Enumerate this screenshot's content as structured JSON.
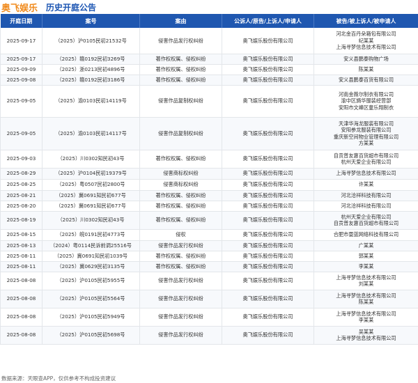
{
  "header": {
    "brand": "奥飞娱乐",
    "title": "历史开庭公告"
  },
  "table": {
    "columns": [
      "开庭日期",
      "案号",
      "案由",
      "公诉人/原告/上诉人/申请人",
      "被告/被上诉人/被申请人"
    ],
    "rows": [
      {
        "date": "2025-09-17",
        "case": "（2025）沪0105民初21532号",
        "cause": "侵害作品发行权纠纷",
        "plaintiff": "奥飞娱乐股份有限公司",
        "defendants": [
          "河北金百丹朵箱包有限公司",
          "纪某某",
          "上海寻梦信息技术有限公司"
        ]
      },
      {
        "date": "2025-09-17",
        "case": "（2025）赣0192民初3269号",
        "cause": "著作权权属、侵权纠纷",
        "plaintiff": "奥飞娱乐股份有限公司",
        "defendants": [
          "安义县鹏泰购物广场"
        ]
      },
      {
        "date": "2025-09-09",
        "case": "（2025）浙0213民初4896号",
        "cause": "著作权权属、侵权纠纷",
        "plaintiff": "奥飞娱乐股份有限公司",
        "defendants": [
          "陈某某"
        ]
      },
      {
        "date": "2025-09-08",
        "case": "（2025）赣0192民初3186号",
        "cause": "著作权权属、侵权纠纷",
        "plaintiff": "奥飞娱乐股份有限公司",
        "defendants": [
          "安义县鹏泰百货有限公司"
        ]
      },
      {
        "date": "2025-09-05",
        "case": "（2025）渝0103民初14119号",
        "cause": "侵害作品复制权纠纷",
        "plaintiff": "奥飞娱乐股份有限公司",
        "defendants": [
          "河南金薇尔制衣有限公司",
          "渝中区旖华服装经营部",
          "安阳市文峰区童乐翔制衣"
        ]
      },
      {
        "date": "2025-09-05",
        "case": "（2025）渝0103民初14117号",
        "cause": "侵害作品复制权纠纷",
        "plaintiff": "奥飞娱乐股份有限公司",
        "defendants": [
          "天津华海龙服装有限公司",
          "安阳参龙服装有限公司",
          "重庆新空间物业管理有限公司",
          "方某某"
        ]
      },
      {
        "date": "2025-09-03",
        "case": "（2025）川0302知民初43号",
        "cause": "著作权权属、侵权纠纷",
        "plaintiff": "奥飞娱乐股份有限公司",
        "defendants": [
          "自贡普友惠百货超市有限公司",
          "杭州天爱企业有限公司"
        ]
      },
      {
        "date": "2025-08-29",
        "case": "（2025）沪0104民初19379号",
        "cause": "侵害商标权纠纷",
        "plaintiff": "奥飞娱乐股份有限公司",
        "defendants": [
          "上海寻梦信息技术有限公司"
        ]
      },
      {
        "date": "2025-08-25",
        "case": "（2025）粤0507民初2800号",
        "cause": "侵害商标权纠纷",
        "plaintiff": "奥飞娱乐股份有限公司",
        "defendants": [
          "许某某"
        ]
      },
      {
        "date": "2025-08-21",
        "case": "（2025）冀0691知民初677号",
        "cause": "著作权权属、侵权纠纷",
        "plaintiff": "奥飞娱乐股份有限公司",
        "defendants": [
          "河北洽祥科技有限公司"
        ]
      },
      {
        "date": "2025-08-20",
        "case": "（2025）冀0691知民初677号",
        "cause": "著作权权属、侵权纠纷",
        "plaintiff": "奥飞娱乐股份有限公司",
        "defendants": [
          "河北洽祥科技有限公司"
        ]
      },
      {
        "date": "2025-08-19",
        "case": "（2025）川0302知民初43号",
        "cause": "著作权权属、侵权纠纷",
        "plaintiff": "奥飞娱乐股份有限公司",
        "defendants": [
          "杭州天爱企业有限公司",
          "自贡普友惠百货超市有限公司"
        ]
      },
      {
        "date": "2025-08-15",
        "case": "（2025）皖0191民初4773号",
        "cause": "侵权",
        "plaintiff": "奥飞娱乐股份有限公司",
        "defendants": [
          "合肥市耍蓝网络科技有限公司"
        ]
      },
      {
        "date": "2025-08-13",
        "case": "（2024）粤0114民诉前调25516号",
        "cause": "侵害作品发行权纠纷",
        "plaintiff": "奥飞娱乐股份有限公司",
        "defendants": [
          "广某某"
        ]
      },
      {
        "date": "2025-08-11",
        "case": "（2025）冀0691知民初1039号",
        "cause": "著作权权属、侵权纠纷",
        "plaintiff": "奥飞娱乐股份有限公司",
        "defendants": [
          "郭某某"
        ]
      },
      {
        "date": "2025-08-11",
        "case": "（2025）冀0629民初3135号",
        "cause": "著作权权属、侵权纠纷",
        "plaintiff": "奥飞娱乐股份有限公司",
        "defendants": [
          "李某某"
        ]
      },
      {
        "date": "2025-08-08",
        "case": "（2025）沪0105民初5955号",
        "cause": "侵害作品发行权纠纷",
        "plaintiff": "奥飞娱乐股份有限公司",
        "defendants": [
          "上海寻梦信息技术有限公司",
          "刘某某"
        ]
      },
      {
        "date": "2025-08-08",
        "case": "（2025）沪0105民初5564号",
        "cause": "侵害作品发行权纠纷",
        "plaintiff": "奥飞娱乐股份有限公司",
        "defendants": [
          "上海寻梦信息技术有限公司",
          "陈某某"
        ]
      },
      {
        "date": "2025-08-08",
        "case": "（2025）沪0105民初5949号",
        "cause": "侵害作品发行权纠纷",
        "plaintiff": "奥飞娱乐股份有限公司",
        "defendants": [
          "上海寻梦信息技术有限公司",
          "李某某"
        ]
      },
      {
        "date": "2025-08-08",
        "case": "（2025）沪0105民初5698号",
        "cause": "侵害作品发行权纠纷",
        "plaintiff": "奥飞娱乐股份有限公司",
        "defendants": [
          "吴某某",
          "上海寻梦信息技术有限公司"
        ]
      }
    ]
  },
  "footer": {
    "text": "数据来源：天眼查APP，仅供参考不构成投资建议"
  },
  "colors": {
    "brand": "#f08a1c",
    "title": "#1d56b3",
    "header_bg": "#1f57b0"
  }
}
